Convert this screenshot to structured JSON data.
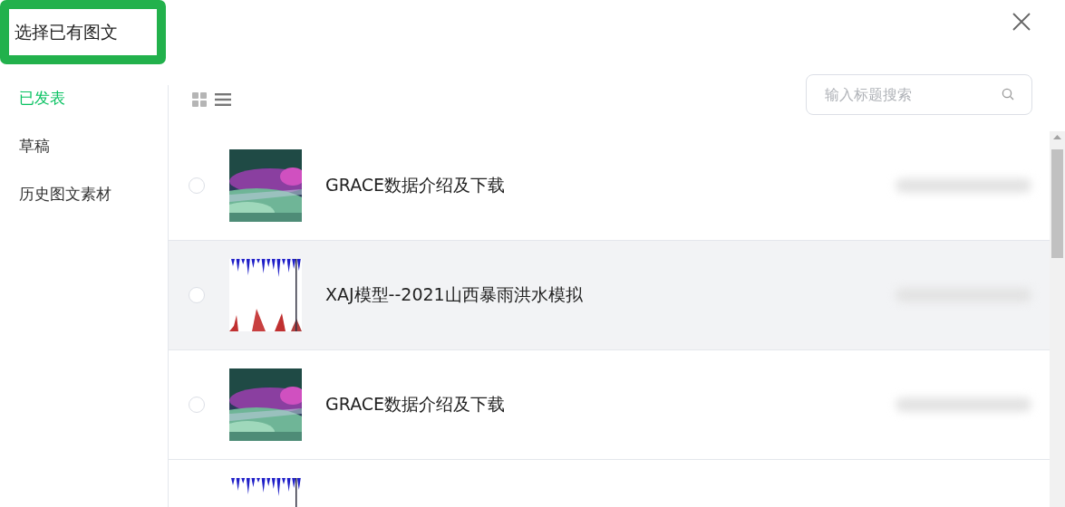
{
  "dialog": {
    "title": "选择已有图文",
    "highlighted": true
  },
  "sidebar": {
    "items": [
      {
        "label": "已发表",
        "selected": true
      },
      {
        "label": "草稿",
        "selected": false
      },
      {
        "label": "历史图文素材",
        "selected": false
      }
    ]
  },
  "toolbar": {
    "view_modes": [
      {
        "kind": "grid",
        "selected": false
      },
      {
        "kind": "list",
        "selected": true
      }
    ]
  },
  "search": {
    "placeholder": "输入标题搜索"
  },
  "rows": [
    {
      "title": "GRACE数据介绍及下载",
      "selected": false,
      "hovered": false
    },
    {
      "title": "XAJ模型--2021山西暴雨洪水模拟",
      "selected": false,
      "hovered": true
    },
    {
      "title": "GRACE数据介绍及下载",
      "selected": false,
      "hovered": false
    },
    {}
  ]
}
